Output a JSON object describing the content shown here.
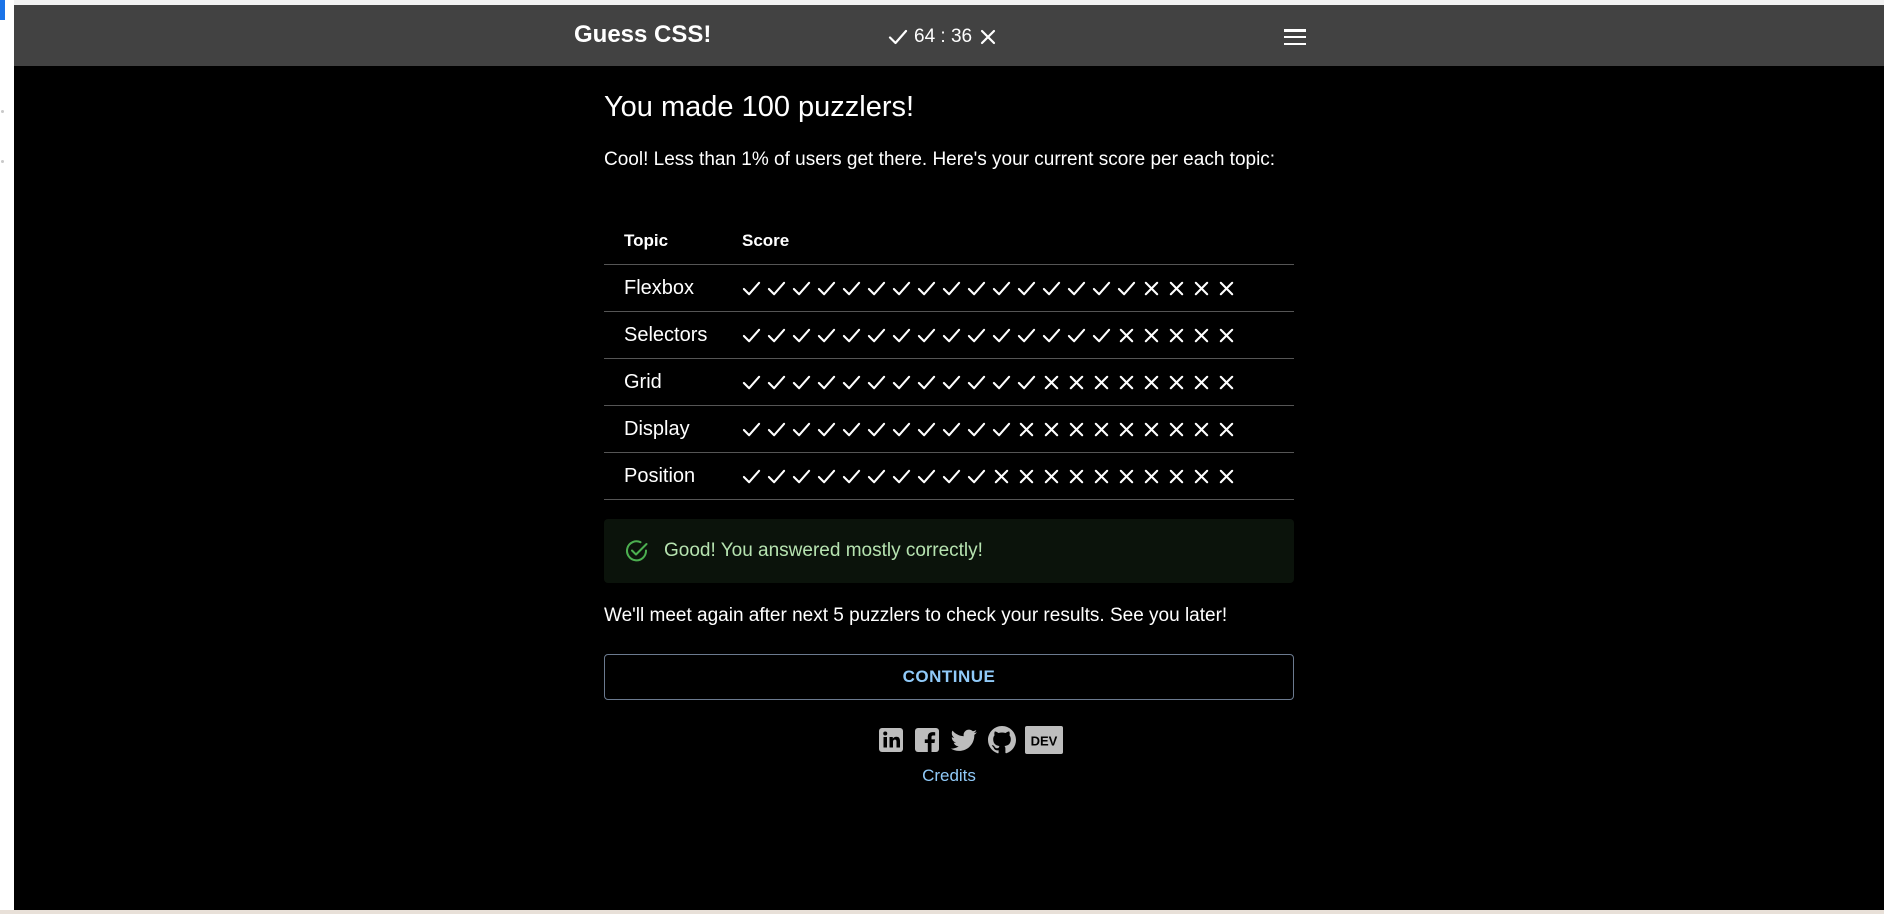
{
  "header": {
    "brand": "Guess CSS!",
    "score_counter": "64 : 36",
    "correct_icon": "check-icon",
    "wrong_icon": "cross-icon",
    "menu_icon": "hamburger-menu-icon"
  },
  "main": {
    "title": "You made 100 puzzlers!",
    "intro": "Cool! Less than 1% of users get there. Here's your current score per each topic:",
    "table": {
      "columns": [
        "Topic",
        "Score"
      ],
      "rows": [
        {
          "topic": "Flexbox",
          "correct": 16,
          "wrong": 4
        },
        {
          "topic": "Selectors",
          "correct": 15,
          "wrong": 5
        },
        {
          "topic": "Grid",
          "correct": 12,
          "wrong": 8
        },
        {
          "topic": "Display",
          "correct": 11,
          "wrong": 9
        },
        {
          "topic": "Position",
          "correct": 10,
          "wrong": 10
        }
      ]
    },
    "alert": {
      "icon": "check-circle-icon",
      "text": "Good! You answered mostly correctly!"
    },
    "later_text": "We'll meet again after next 5 puzzlers to check your results. See you later!",
    "continue_label": "CONTINUE"
  },
  "footer": {
    "social_icons": [
      "linkedin-icon",
      "facebook-icon",
      "twitter-icon",
      "github-icon",
      "dev-icon"
    ],
    "dev_label": "DEV",
    "credits_label": "Credits"
  },
  "colors": {
    "topbar": "#424242",
    "background": "#000000",
    "accent": "#90caf9",
    "success_text": "#b6e3b0",
    "success_icon": "#4caf50"
  }
}
